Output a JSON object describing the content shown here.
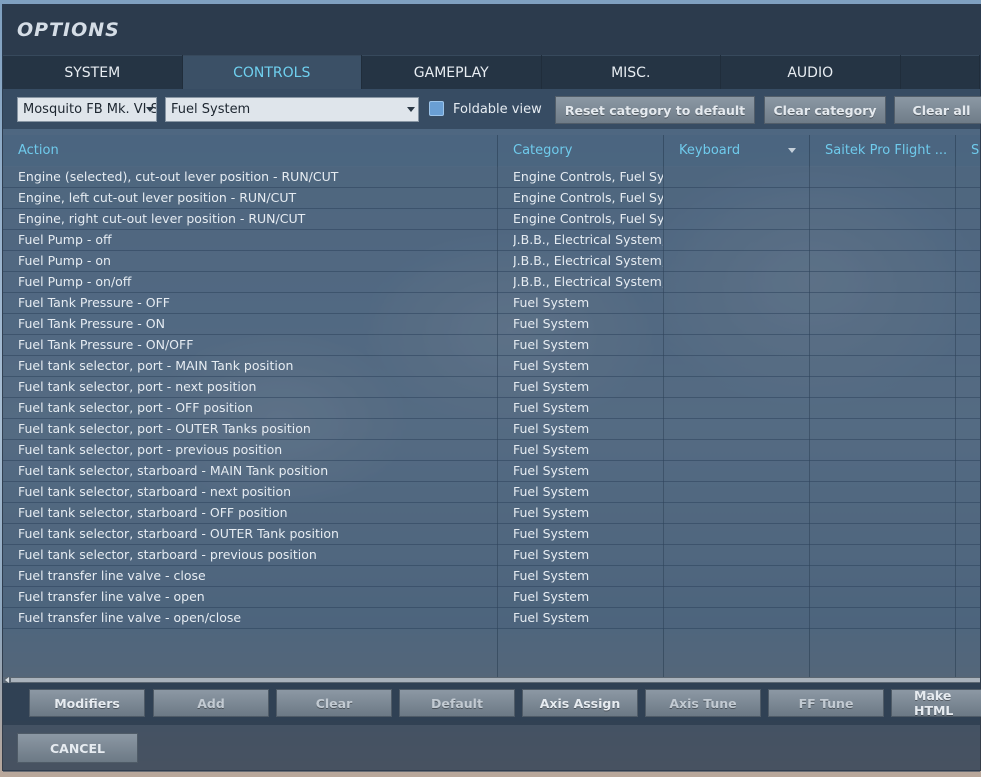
{
  "window": {
    "title": "OPTIONS"
  },
  "tabs": [
    "SYSTEM",
    "CONTROLS",
    "GAMEPLAY",
    "MISC.",
    "AUDIO"
  ],
  "active_tab": "CONTROLS",
  "toolbar": {
    "aircraft_select": "Mosquito FB Mk. VI S",
    "category_select": "Fuel System",
    "foldable_label": "Foldable view",
    "foldable_checked": true,
    "reset_button": "Reset category to default",
    "clear_category_button": "Clear category",
    "clear_all_button": "Clear all"
  },
  "table": {
    "headers": {
      "action": "Action",
      "category": "Category",
      "keyboard": "Keyboard",
      "device1": "Saitek Pro Flight ...",
      "device2": "Sa"
    },
    "rows": [
      {
        "action": "Engine (selected), cut-out lever position - RUN/CUT",
        "category": "Engine Controls, Fuel Syst"
      },
      {
        "action": "Engine, left cut-out lever position - RUN/CUT",
        "category": "Engine Controls, Fuel Syst"
      },
      {
        "action": "Engine, right cut-out lever position - RUN/CUT",
        "category": "Engine Controls, Fuel Syst"
      },
      {
        "action": "Fuel Pump - off",
        "category": "J.B.B., Electrical System, F"
      },
      {
        "action": "Fuel Pump - on",
        "category": "J.B.B., Electrical System, F"
      },
      {
        "action": "Fuel Pump - on/off",
        "category": "J.B.B., Electrical System, F"
      },
      {
        "action": "Fuel Tank Pressure - OFF",
        "category": "Fuel System"
      },
      {
        "action": "Fuel Tank Pressure - ON",
        "category": "Fuel System"
      },
      {
        "action": "Fuel Tank Pressure - ON/OFF",
        "category": "Fuel System"
      },
      {
        "action": "Fuel tank selector, port - MAIN Tank position",
        "category": "Fuel System"
      },
      {
        "action": "Fuel tank selector, port - next position",
        "category": "Fuel System"
      },
      {
        "action": "Fuel tank selector, port - OFF position",
        "category": "Fuel System"
      },
      {
        "action": "Fuel tank selector, port - OUTER Tanks position",
        "category": "Fuel System"
      },
      {
        "action": "Fuel tank selector, port - previous position",
        "category": "Fuel System"
      },
      {
        "action": "Fuel tank selector, starboard - MAIN Tank position",
        "category": "Fuel System"
      },
      {
        "action": "Fuel tank selector, starboard - next position",
        "category": "Fuel System"
      },
      {
        "action": "Fuel tank selector, starboard - OFF position",
        "category": "Fuel System"
      },
      {
        "action": "Fuel tank selector, starboard - OUTER Tank position",
        "category": "Fuel System"
      },
      {
        "action": "Fuel tank selector, starboard - previous position",
        "category": "Fuel System"
      },
      {
        "action": "Fuel transfer line valve - close",
        "category": "Fuel System"
      },
      {
        "action": "Fuel transfer line valve - open",
        "category": "Fuel System"
      },
      {
        "action": "Fuel transfer line valve - open/close",
        "category": "Fuel System"
      }
    ]
  },
  "bottom_buttons": [
    "Modifiers",
    "Add",
    "Clear",
    "Default",
    "Axis Assign",
    "Axis Tune",
    "FF Tune",
    "Make HTML"
  ],
  "footer": {
    "cancel": "CANCEL"
  },
  "colors": {
    "accent": "#6fd0ef",
    "panel": "#2c3b4d"
  }
}
